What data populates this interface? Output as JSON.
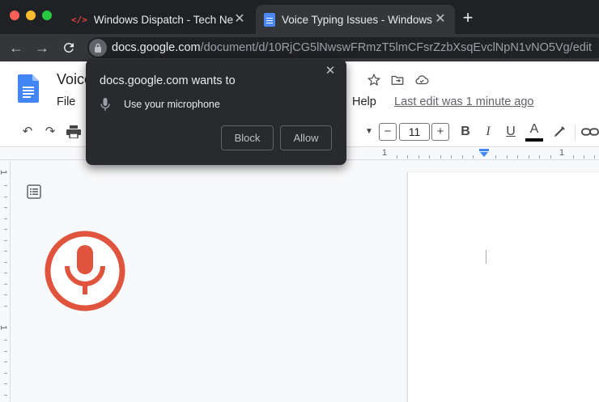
{
  "browser": {
    "tabs": [
      {
        "title": "Windows Dispatch - Tech News",
        "favicon": "code-icon",
        "active": false
      },
      {
        "title": "Voice Typing Issues - Windows",
        "favicon": "docs-icon",
        "active": true
      }
    ],
    "newtab_label": "+",
    "url_host": "docs.google.com",
    "url_path": "/document/d/10RjCG5lNwswFRmzT5lmCFsrZzbXsqEvclNpN1vNO5Vg/edit"
  },
  "docs": {
    "title": "Voice",
    "menu": [
      "File",
      "Help"
    ],
    "last_edit": "Last edit was 1 minute ago",
    "font_size": "11",
    "minus_label": "−",
    "plus_label": "+",
    "bold_label": "B",
    "italic_label": "I",
    "underline_label": "U",
    "textcolor_label": "A",
    "ruler_numbers": [
      "1",
      "1"
    ],
    "vruler_number": "1"
  },
  "popup": {
    "title": "docs.google.com wants to",
    "permission": "Use your microphone",
    "block_label": "Block",
    "allow_label": "Allow",
    "close_label": "✕"
  },
  "colors": {
    "mic_accent": "#e0533d",
    "docs_blue": "#4285f4"
  }
}
